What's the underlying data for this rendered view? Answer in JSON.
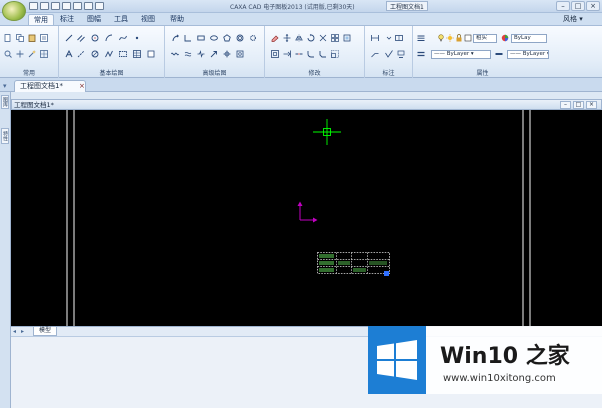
{
  "window": {
    "title": "CAXA CAD 电子图板2013 (试用版,已剩30天)",
    "doc_name": "工程图文档1",
    "minimize": "–",
    "maximize": "□",
    "close": "×"
  },
  "menu": {
    "tabs": [
      "常用",
      "标注",
      "图幅",
      "工具",
      "视图",
      "帮助"
    ],
    "active": "常用",
    "user": "风格 ▾"
  },
  "ribbon": {
    "groups": [
      {
        "label": "常用"
      },
      {
        "label": "基本绘图"
      },
      {
        "label": "高级绘图"
      },
      {
        "label": "修改"
      },
      {
        "label": "标注"
      },
      {
        "label": "属性"
      }
    ],
    "combos": {
      "layer": "粗实",
      "color": "ByLay",
      "linetype": "—— ByLayer ▾",
      "linewidth": "—— ByLayer ▾"
    }
  },
  "document": {
    "tab_label": "工程图文档1*",
    "tab_close": "×",
    "window_title": "工程图文档1*"
  },
  "rail": {
    "tab1": "图库",
    "tab2": "特性"
  },
  "layout": {
    "model_tab": "模型"
  },
  "watermark": {
    "brand": "Win10 之家",
    "url": "www.win10xitong.com"
  },
  "colors": {
    "canvas": "#000000",
    "cursor": "#00ff00",
    "ucs": "#c000c0",
    "titleblock": "#9bdc7a",
    "watermark_blue": "#1d7ed4"
  }
}
